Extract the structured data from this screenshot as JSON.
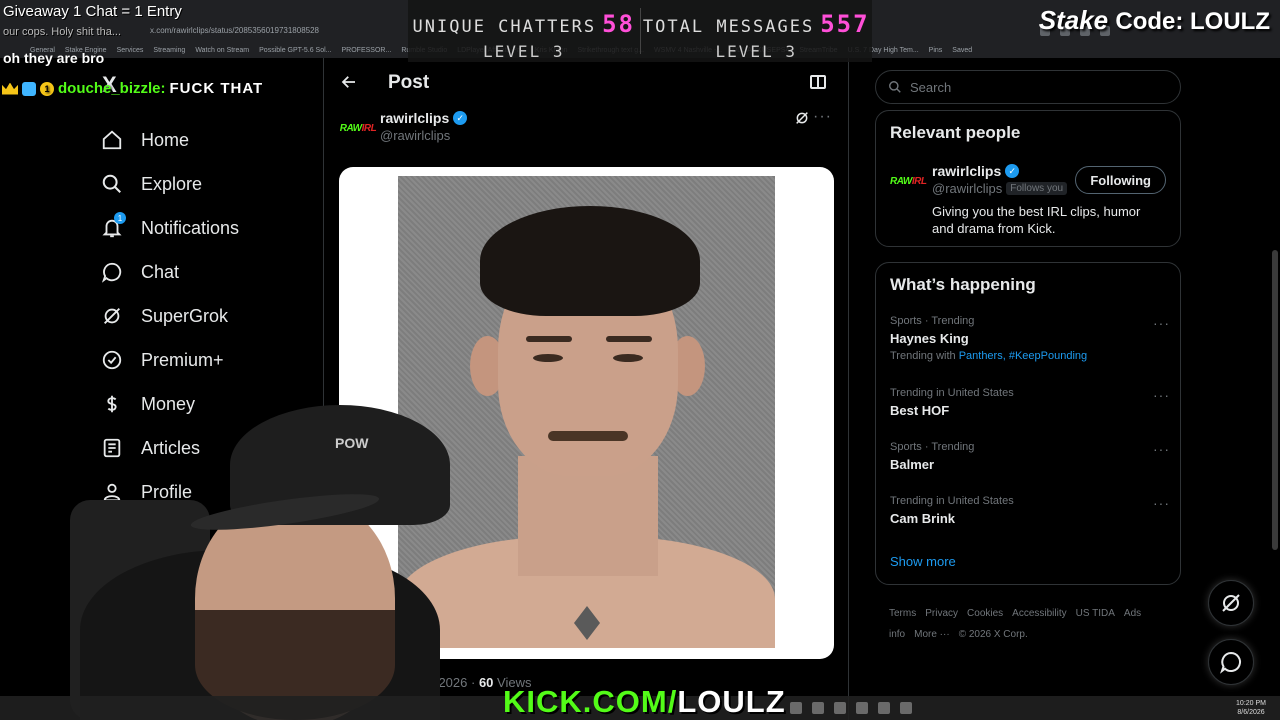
{
  "browser": {
    "url": "x.com/rawirlclips/status/2085356019731808528",
    "bookmarks": [
      "General",
      "Stake Engine",
      "Services",
      "Streaming",
      "Watch on Stream",
      "Possible GPT-5.6 Sol...",
      "PROFESSOR...",
      "Rumble Studio",
      "LDPlayer Affiliate Pr...",
      "Kris Krohn",
      "Strikethrough text g...",
      "WSMV 4 Nashville -...",
      "DLL-ARKUSEPS4",
      "StreamTribe",
      "U.S. 7 Day High Tem...",
      "Pins",
      "Saved"
    ]
  },
  "overlay": {
    "giveaway": "Giveaway 1 Chat = 1 Entry",
    "chat_ghost": "our cops. Holy shit tha...",
    "chat_line1": "oh they are bro",
    "chat_user": "douche_bizzle:",
    "chat_badge": "1",
    "chat_message": "FUCK THAT",
    "stats": {
      "unique_label": "UNIQUE CHATTERS",
      "unique_value": "58",
      "unique_level": "LEVEL 3",
      "total_label": "TOTAL MESSAGES",
      "total_value": "557",
      "total_level": "LEVEL 3"
    },
    "stake_brand": "Stake",
    "stake_code": "Code: LOULZ",
    "kick_prefix": "KICK.COM/",
    "kick_name": "LOULZ",
    "cap_logo": "POW"
  },
  "nav": {
    "logo": "X",
    "items": [
      {
        "label": "Home",
        "icon": "home-icon"
      },
      {
        "label": "Explore",
        "icon": "search-icon"
      },
      {
        "label": "Notifications",
        "icon": "bell-icon",
        "badge": "1"
      },
      {
        "label": "Chat",
        "icon": "chat-bubble-icon"
      },
      {
        "label": "SuperGrok",
        "icon": "grok-icon"
      },
      {
        "label": "Premium+",
        "icon": "premium-check-icon"
      },
      {
        "label": "Money",
        "icon": "dollar-icon"
      },
      {
        "label": "Articles",
        "icon": "article-icon"
      },
      {
        "label": "Profile",
        "icon": "person-icon"
      }
    ]
  },
  "post": {
    "header_title": "Post",
    "author_name": "rawirlclips",
    "author_handle": "@rawirlclips",
    "avatar_logo_a": "RAW",
    "avatar_logo_b": "IRL",
    "date": "6, 2026 ·",
    "views_count": "60",
    "views_label": "Views"
  },
  "sidebar": {
    "search_placeholder": "Search",
    "relevant_title": "Relevant people",
    "relevant": {
      "name": "rawirlclips",
      "handle": "@rawirlclips",
      "follows_you": "Follows you",
      "button": "Following",
      "bio": "Giving you the best IRL clips, humor and drama from Kick."
    },
    "happening_title": "What’s happening",
    "trends": [
      {
        "meta": "Sports · Trending",
        "name": "Haynes King",
        "with_prefix": "Trending with",
        "with_links": "Panthers, #KeepPounding"
      },
      {
        "meta": "Trending in United States",
        "name": "Best HOF"
      },
      {
        "meta": "Sports · Trending",
        "name": "Balmer"
      },
      {
        "meta": "Trending in United States",
        "name": "Cam Brink"
      }
    ],
    "show_more": "Show more",
    "footer": [
      "Terms",
      "Privacy",
      "Cookies",
      "Accessibility",
      "US TIDA",
      "Ads info",
      "More ···",
      "© 2026 X Corp."
    ]
  },
  "taskbar": {
    "time": "10:20 PM",
    "date": "8/6/2026"
  },
  "colors": {
    "accent": "#1d9bf0",
    "kick_green": "#53fc18",
    "stats_pink": "#ff4fd8",
    "bg": "#000000"
  }
}
